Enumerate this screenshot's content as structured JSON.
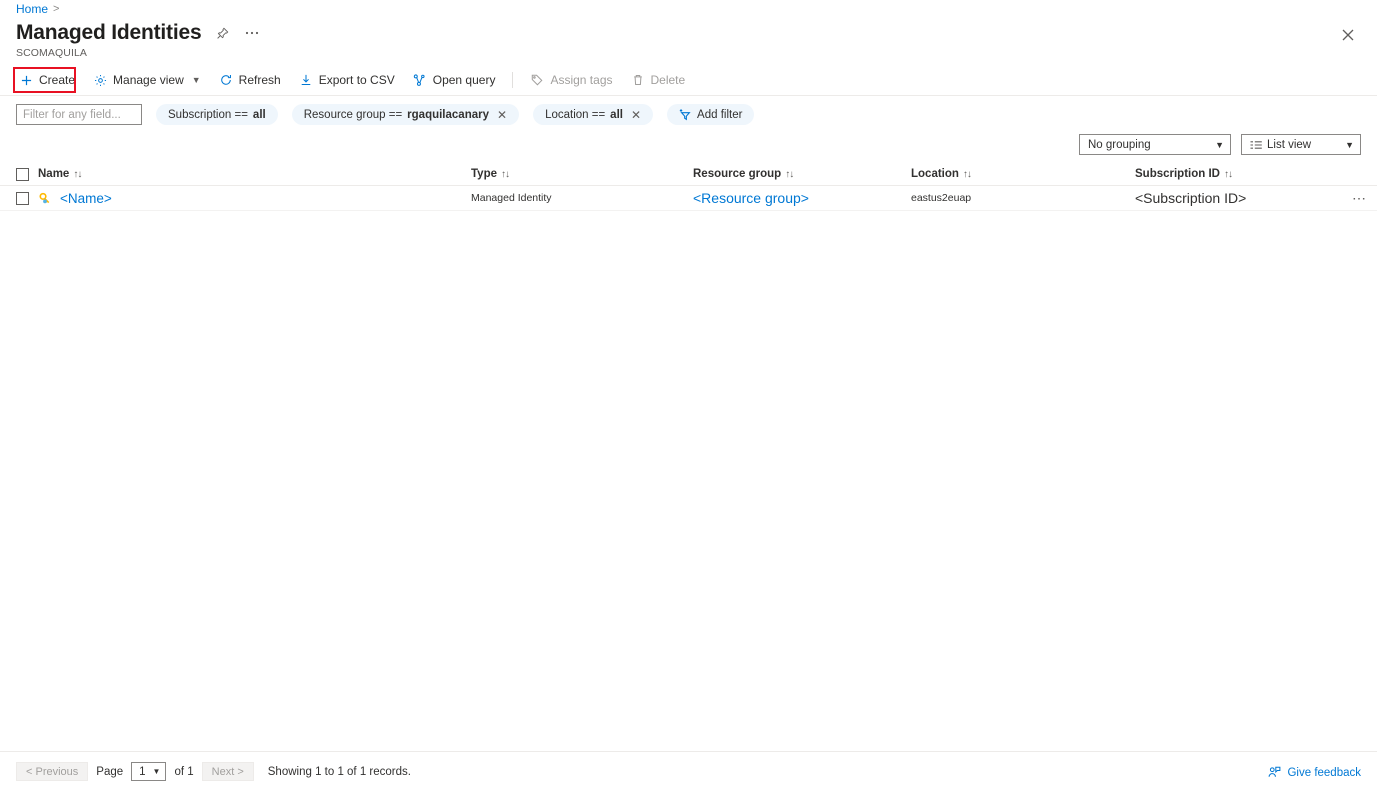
{
  "breadcrumb": {
    "home": "Home",
    "separator": ">"
  },
  "header": {
    "title": "Managed Identities",
    "subtitle": "SCOMAQUILA",
    "pin_icon": "pin-icon",
    "more_icon": "ellipsis-icon",
    "close_icon": "close-icon"
  },
  "toolbar": {
    "create": "Create",
    "manage_view": "Manage view",
    "refresh": "Refresh",
    "export_csv": "Export to CSV",
    "open_query": "Open query",
    "assign_tags": "Assign tags",
    "delete": "Delete",
    "highlight_color": "#e81123"
  },
  "filters": {
    "search_placeholder": "Filter for any field...",
    "search_value": "",
    "pills": [
      {
        "label": "Subscription ==",
        "value": "all",
        "removable": false
      },
      {
        "label": "Resource group ==",
        "value": "rgaquilacanary",
        "removable": true
      },
      {
        "label": "Location ==",
        "value": "all",
        "removable": true
      }
    ],
    "add_filter": "Add filter"
  },
  "view_controls": {
    "grouping": "No grouping",
    "view": "List view"
  },
  "table": {
    "columns": [
      {
        "label": "Name",
        "sortable": true
      },
      {
        "label": "Type",
        "sortable": true
      },
      {
        "label": "Resource group",
        "sortable": true
      },
      {
        "label": "Location",
        "sortable": true
      },
      {
        "label": "Subscription ID",
        "sortable": true
      }
    ],
    "rows": [
      {
        "name": "<Name>",
        "type": "Managed Identity",
        "resource_group": "<Resource group>",
        "location": "eastus2euap",
        "subscription_id": "<Subscription ID>",
        "icon": "managed-identity-key-icon"
      }
    ]
  },
  "footer": {
    "previous": "< Previous",
    "page_label": "Page",
    "page_value": "1",
    "of_label": "of 1",
    "next": "Next >",
    "showing": "Showing 1 to 1 of 1 records.",
    "give_feedback": "Give feedback"
  },
  "colors": {
    "accent": "#0078d4",
    "pill_bg": "#eff6fc",
    "highlight": "#e81123",
    "key_icon": "#ffb900"
  }
}
